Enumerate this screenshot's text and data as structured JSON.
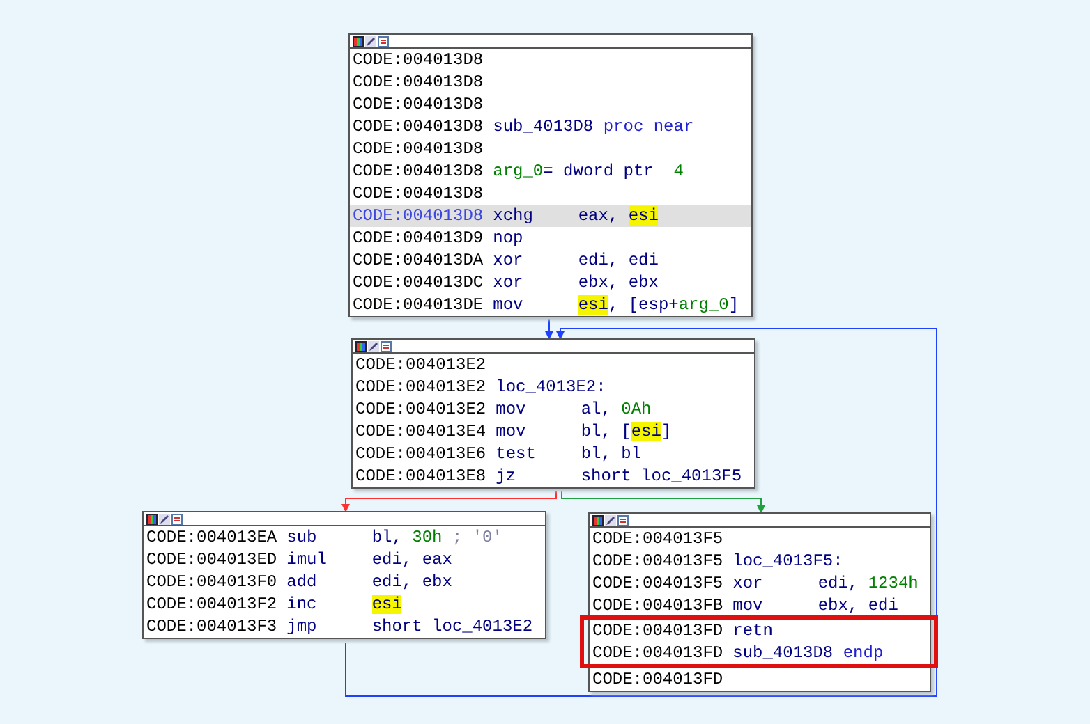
{
  "nodes": [
    {
      "lines": [
        {
          "addr": "CODE:004013D8",
          "selected": false
        },
        {
          "addr": "CODE:004013D8",
          "selected": false
        },
        {
          "addr": "CODE:004013D8",
          "selected": false
        },
        {
          "addr": "CODE:004013D8",
          "selected": false,
          "parts": [
            {
              "text": "sub_4013D8 ",
              "kind": "name"
            },
            {
              "text": "proc near",
              "kind": "keyword"
            }
          ]
        },
        {
          "addr": "CODE:004013D8",
          "selected": false
        },
        {
          "addr": "CODE:004013D8",
          "selected": false,
          "parts": [
            {
              "text": "arg_0",
              "kind": "number"
            },
            {
              "text": "= dword ptr  ",
              "kind": "name"
            },
            {
              "text": "4",
              "kind": "number"
            }
          ]
        },
        {
          "addr": "CODE:004013D8",
          "selected": false
        },
        {
          "addr": "CODE:004013D8",
          "selected": true,
          "parts": [
            {
              "text": "xchg",
              "kind": "mnemonic"
            },
            {
              "text": "eax, ",
              "kind": "operand"
            },
            {
              "text": "esi",
              "kind": "highlight"
            }
          ]
        },
        {
          "addr": "CODE:004013D9",
          "selected": false,
          "parts": [
            {
              "text": "nop",
              "kind": "mnemonic"
            }
          ]
        },
        {
          "addr": "CODE:004013DA",
          "selected": false,
          "parts": [
            {
              "text": "xor",
              "kind": "mnemonic"
            },
            {
              "text": "edi, edi",
              "kind": "operand"
            }
          ]
        },
        {
          "addr": "CODE:004013DC",
          "selected": false,
          "parts": [
            {
              "text": "xor",
              "kind": "mnemonic"
            },
            {
              "text": "ebx, ebx",
              "kind": "operand"
            }
          ]
        },
        {
          "addr": "CODE:004013DE",
          "selected": false,
          "parts": [
            {
              "text": "mov",
              "kind": "mnemonic"
            },
            {
              "text": "esi",
              "kind": "highlight"
            },
            {
              "text": ", [esp+",
              "kind": "operand"
            },
            {
              "text": "arg_0",
              "kind": "number"
            },
            {
              "text": "]",
              "kind": "operand"
            }
          ]
        }
      ]
    },
    {
      "lines": [
        {
          "addr": "CODE:004013E2",
          "selected": false
        },
        {
          "addr": "CODE:004013E2",
          "selected": false,
          "parts": [
            {
              "text": "loc_4013E2:",
              "kind": "name"
            }
          ]
        },
        {
          "addr": "CODE:004013E2",
          "selected": false,
          "parts": [
            {
              "text": "mov",
              "kind": "mnemonic"
            },
            {
              "text": "al, ",
              "kind": "operand"
            },
            {
              "text": "0Ah",
              "kind": "number"
            }
          ]
        },
        {
          "addr": "CODE:004013E4",
          "selected": false,
          "parts": [
            {
              "text": "mov",
              "kind": "mnemonic"
            },
            {
              "text": "bl, [",
              "kind": "operand"
            },
            {
              "text": "esi",
              "kind": "highlight"
            },
            {
              "text": "]",
              "kind": "operand"
            }
          ]
        },
        {
          "addr": "CODE:004013E6",
          "selected": false,
          "parts": [
            {
              "text": "test",
              "kind": "mnemonic"
            },
            {
              "text": "bl, bl",
              "kind": "operand"
            }
          ]
        },
        {
          "addr": "CODE:004013E8",
          "selected": false,
          "parts": [
            {
              "text": "jz",
              "kind": "mnemonic"
            },
            {
              "text": "short loc_4013F5",
              "kind": "operand"
            }
          ]
        }
      ]
    },
    {
      "lines": [
        {
          "addr": "CODE:004013EA",
          "selected": false,
          "parts": [
            {
              "text": "sub",
              "kind": "mnemonic"
            },
            {
              "text": "bl, ",
              "kind": "operand"
            },
            {
              "text": "30h",
              "kind": "number"
            },
            {
              "text": " ; '0'",
              "kind": "comment"
            }
          ]
        },
        {
          "addr": "CODE:004013ED",
          "selected": false,
          "parts": [
            {
              "text": "imul",
              "kind": "mnemonic"
            },
            {
              "text": "edi, eax",
              "kind": "operand"
            }
          ]
        },
        {
          "addr": "CODE:004013F0",
          "selected": false,
          "parts": [
            {
              "text": "add",
              "kind": "mnemonic"
            },
            {
              "text": "edi, ebx",
              "kind": "operand"
            }
          ]
        },
        {
          "addr": "CODE:004013F2",
          "selected": false,
          "parts": [
            {
              "text": "inc",
              "kind": "mnemonic"
            },
            {
              "text": "esi",
              "kind": "highlight"
            }
          ]
        },
        {
          "addr": "CODE:004013F3",
          "selected": false,
          "parts": [
            {
              "text": "jmp",
              "kind": "mnemonic"
            },
            {
              "text": "short loc_4013E2",
              "kind": "operand"
            }
          ]
        }
      ]
    },
    {
      "lines": [
        {
          "addr": "CODE:004013F5",
          "selected": false
        },
        {
          "addr": "CODE:004013F5",
          "selected": false,
          "parts": [
            {
              "text": "loc_4013F5:",
              "kind": "name"
            }
          ]
        },
        {
          "addr": "CODE:004013F5",
          "selected": false,
          "parts": [
            {
              "text": "xor",
              "kind": "mnemonic"
            },
            {
              "text": "edi, ",
              "kind": "operand"
            },
            {
              "text": "1234h",
              "kind": "number"
            }
          ]
        },
        {
          "addr": "CODE:004013FB",
          "selected": false,
          "parts": [
            {
              "text": "mov",
              "kind": "mnemonic"
            },
            {
              "text": "ebx, edi",
              "kind": "operand"
            }
          ]
        },
        {
          "kind": "frame",
          "lines": [
            {
              "addr": "CODE:004013FD",
              "selected": false,
              "parts": [
                {
                  "text": "retn",
                  "kind": "mnemonic"
                }
              ]
            },
            {
              "addr": "CODE:004013FD",
              "selected": false,
              "parts": [
                {
                  "text": "sub_4013D8 ",
                  "kind": "name"
                },
                {
                  "text": "endp",
                  "kind": "keyword"
                }
              ]
            }
          ]
        },
        {
          "addr": "CODE:004013FD",
          "selected": false
        }
      ]
    }
  ],
  "edges": [
    {
      "kind": "flow"
    },
    {
      "kind": "flow"
    },
    {
      "kind": "false"
    },
    {
      "kind": "true"
    }
  ]
}
